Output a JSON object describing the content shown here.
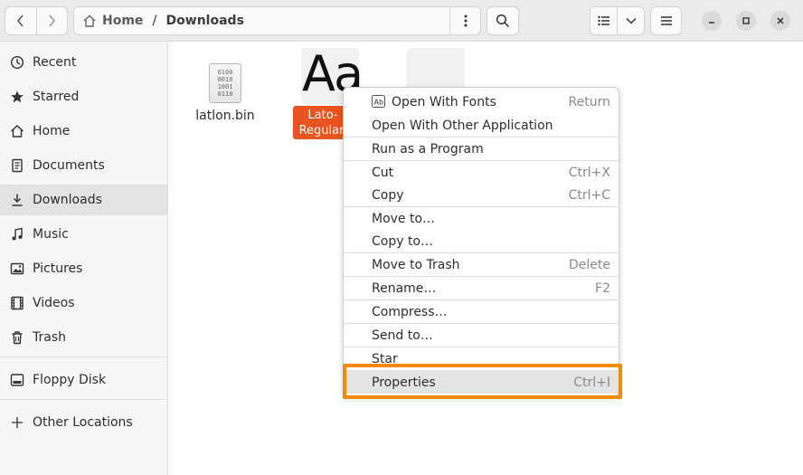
{
  "header": {
    "breadcrumb": [
      "Home",
      "Downloads"
    ],
    "separator": "/"
  },
  "sidebar": {
    "items": [
      {
        "label": "Recent",
        "icon": "clock-icon"
      },
      {
        "label": "Starred",
        "icon": "star-icon"
      },
      {
        "label": "Home",
        "icon": "home-icon"
      },
      {
        "label": "Documents",
        "icon": "document-icon"
      },
      {
        "label": "Downloads",
        "icon": "download-icon"
      },
      {
        "label": "Music",
        "icon": "music-icon"
      },
      {
        "label": "Pictures",
        "icon": "picture-icon"
      },
      {
        "label": "Videos",
        "icon": "video-icon"
      },
      {
        "label": "Trash",
        "icon": "trash-icon"
      }
    ],
    "devices": [
      {
        "label": "Floppy Disk",
        "icon": "floppy-icon"
      }
    ],
    "other": [
      {
        "label": "Other Locations",
        "icon": "plus-icon"
      }
    ]
  },
  "files": [
    {
      "name": "latlon.bin",
      "icon_lines": [
        "0100",
        "0010",
        "1001",
        "0110"
      ]
    },
    {
      "name": "Lato-Regular.ttf",
      "preview": "Aa",
      "label_lines": [
        "Lato-",
        "Regular."
      ]
    }
  ],
  "context_menu": {
    "items": [
      {
        "label": "Open With Fonts",
        "accel": "Return"
      },
      {
        "label": "Open With Other Application",
        "accel": ""
      },
      {
        "label": "Run as a Program",
        "accel": ""
      },
      {
        "label": "Cut",
        "accel": "Ctrl+X"
      },
      {
        "label": "Copy",
        "accel": "Ctrl+C"
      },
      {
        "label": "Move to…",
        "accel": ""
      },
      {
        "label": "Copy to…",
        "accel": ""
      },
      {
        "label": "Move to Trash",
        "accel": "Delete"
      },
      {
        "label": "Rename…",
        "accel": "F2"
      },
      {
        "label": "Compress…",
        "accel": ""
      },
      {
        "label": "Send to…",
        "accel": ""
      },
      {
        "label": "Star",
        "accel": ""
      },
      {
        "label": "Properties",
        "accel": "Ctrl+I"
      }
    ]
  },
  "colors": {
    "accent": "#e95420",
    "highlight_outline": "#f28a0c"
  }
}
